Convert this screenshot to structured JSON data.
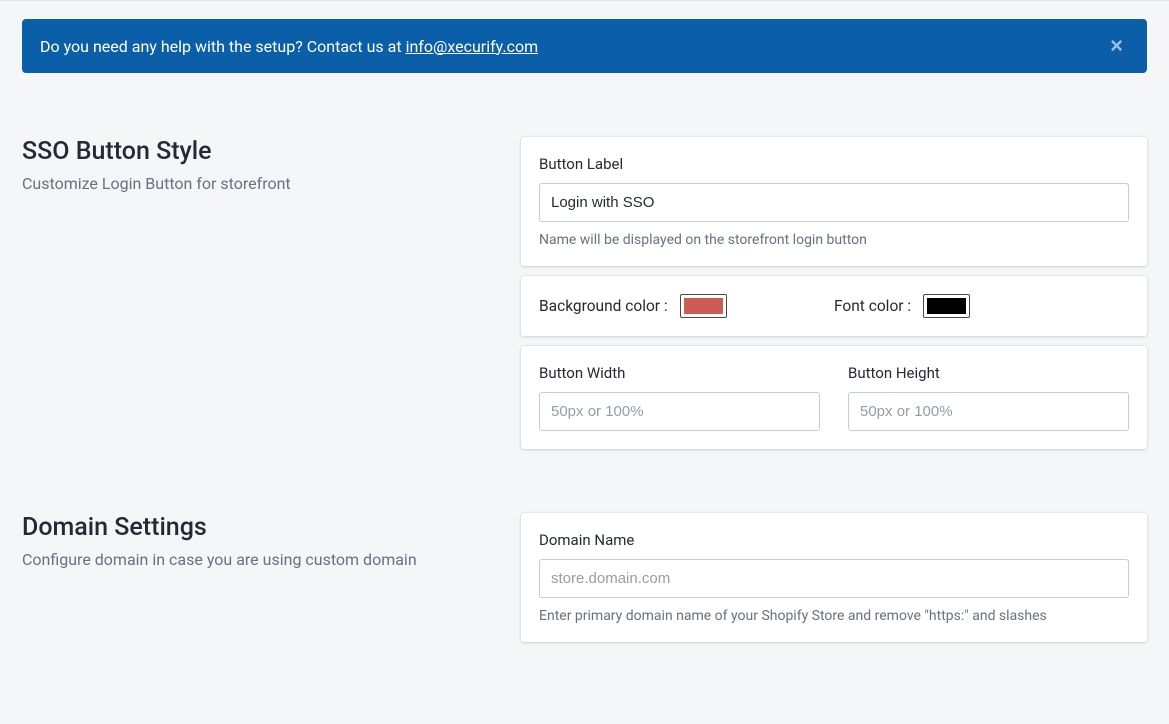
{
  "alert": {
    "text_prefix": "Do you need any help with the setup? Contact us at ",
    "link_text": "info@xecurify.com",
    "close_label": "×"
  },
  "sections": {
    "sso_button_style": {
      "title": "SSO Button Style",
      "subtitle": "Customize Login Button for storefront",
      "button_label": {
        "label": "Button Label",
        "value": "Login with SSO",
        "helper": "Name will be displayed on the storefront login button"
      },
      "colors": {
        "bg_label": "Background color : ",
        "bg_value": "#cc5c54",
        "font_label": "Font color : ",
        "font_value": "#000000"
      },
      "dimensions": {
        "width_label": "Button Width",
        "width_placeholder": "50px or 100%",
        "height_label": "Button Height",
        "height_placeholder": "50px or 100%"
      }
    },
    "domain_settings": {
      "title": "Domain Settings",
      "subtitle": "Configure domain in case you are using custom domain",
      "domain_name": {
        "label": "Domain Name",
        "placeholder": "store.domain.com",
        "helper": "Enter primary domain name of your Shopify Store and remove \"https:\" and slashes"
      }
    }
  }
}
